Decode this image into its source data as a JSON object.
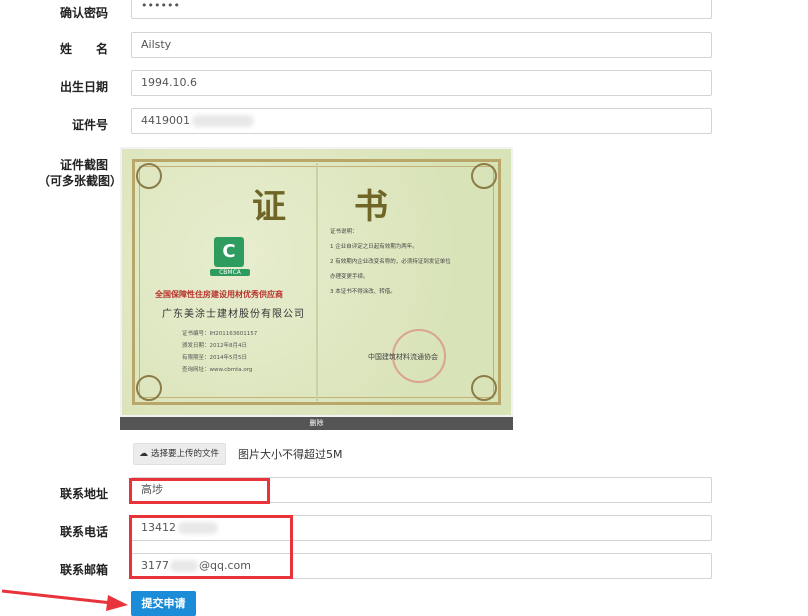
{
  "form": {
    "confirm_password": {
      "label": "确认密码",
      "value": "••••••"
    },
    "name": {
      "label": "姓　　名",
      "value": "Ailsty"
    },
    "birth_date": {
      "label": "出生日期",
      "value": "1994.10.6"
    },
    "id_number": {
      "label": "证件号",
      "value": "4419001"
    },
    "id_screenshot": {
      "label_line1": "证件截图",
      "label_line2": "（可多张截图）"
    },
    "address": {
      "label": "联系地址",
      "value": "高埗"
    },
    "phone": {
      "label": "联系电话",
      "value": "13412"
    },
    "email": {
      "label": "联系邮箱",
      "value_prefix": "3177",
      "value_suffix": "@qq.com"
    }
  },
  "certificate": {
    "title_left": "证",
    "title_right": "书",
    "logo_text": "C",
    "logo_sub": "CBMCA",
    "honor": "全国保障性住房建设用材优秀供应商",
    "company": "广东美涂士建材股份有限公司",
    "cert_no": "证书编号：IH201163601157",
    "issue_date": "颁发日期：2012年8月4日",
    "valid_until": "有限期至：2014年5月5日",
    "website": "查询网址：www.cbmta.org",
    "notes": [
      "证书说明：",
      "1 企业自评定之日起有效期为两年。",
      "2 有效期内企业改变名称的，必须持证到发证单位",
      "办理变更手续。",
      "3 本证书不得涂改、转借。"
    ],
    "org": "中国建筑材料流通协会",
    "delete_label": "删除"
  },
  "upload": {
    "button_label": "选择要上传的文件",
    "icon": "cloud-upload-icon",
    "hint": "图片大小不得超过5M"
  },
  "submit": {
    "label": "提交申请"
  },
  "colors": {
    "annotation_red": "#e8333a",
    "submit_blue": "#1a8cd8"
  }
}
